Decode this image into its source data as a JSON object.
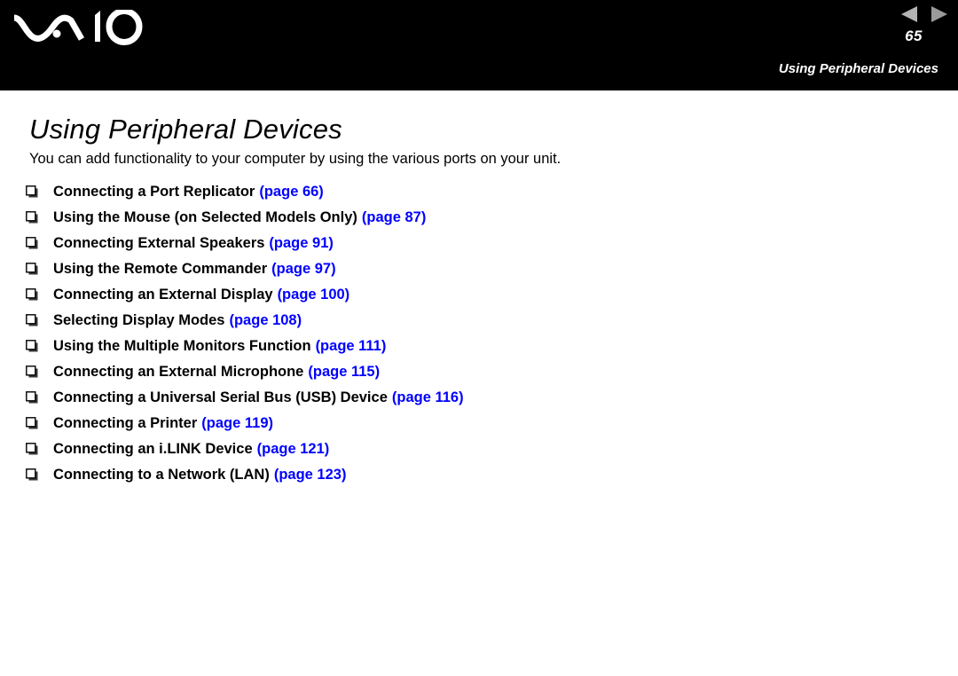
{
  "header": {
    "logo_alt": "VAIO",
    "page_number": "65",
    "running_title": "Using Peripheral Devices",
    "nav": {
      "prev_label": "Previous page",
      "next_label": "Next page"
    }
  },
  "main": {
    "title": "Using Peripheral Devices",
    "intro": "You can add functionality to your computer by using the various ports on your unit.",
    "bullet_glyph": "❑",
    "toc": [
      {
        "label": "Connecting a Port Replicator",
        "pageref": "(page 66)"
      },
      {
        "label": "Using the Mouse (on Selected Models Only)",
        "pageref": "(page 87)"
      },
      {
        "label": "Connecting External Speakers",
        "pageref": "(page 91)"
      },
      {
        "label": "Using the Remote Commander",
        "pageref": "(page 97)"
      },
      {
        "label": "Connecting an External Display",
        "pageref": "(page 100)"
      },
      {
        "label": "Selecting Display Modes",
        "pageref": "(page 108)"
      },
      {
        "label": "Using the Multiple Monitors Function",
        "pageref": "(page 111)"
      },
      {
        "label": "Connecting an External Microphone",
        "pageref": "(page 115)"
      },
      {
        "label": "Connecting a Universal Serial Bus (USB) Device",
        "pageref": "(page 116)"
      },
      {
        "label": "Connecting a Printer",
        "pageref": "(page 119)"
      },
      {
        "label": "Connecting an i.LINK Device",
        "pageref": "(page 121)"
      },
      {
        "label": "Connecting to a Network (LAN)",
        "pageref": "(page 123)"
      }
    ]
  },
  "colors": {
    "header_background": "#000000",
    "page_background": "#ffffff",
    "text": "#000000",
    "link": "#0000ff",
    "header_text": "#ffffff",
    "arrow": "#b4b4b4"
  }
}
